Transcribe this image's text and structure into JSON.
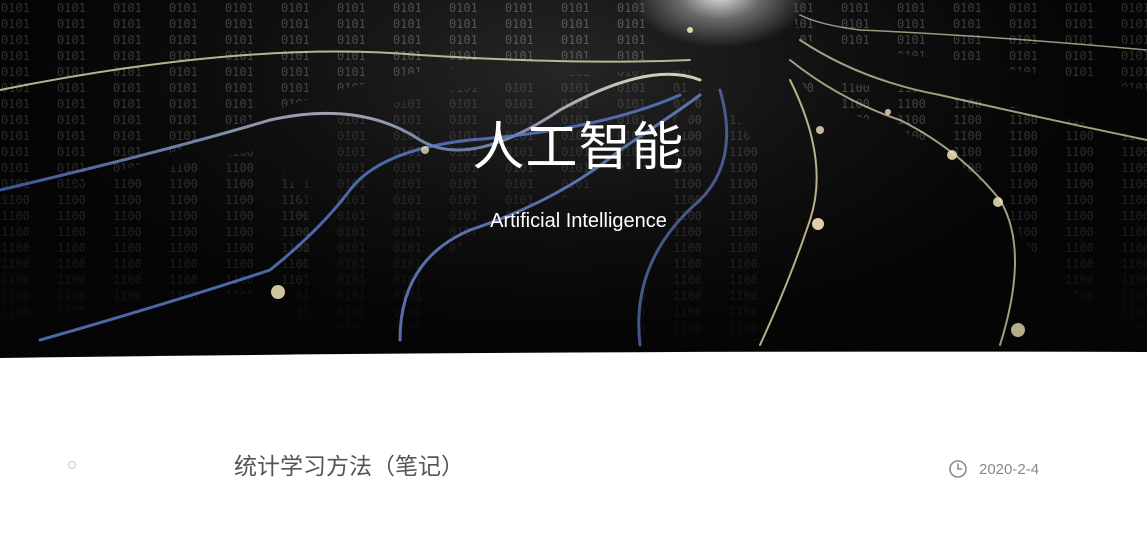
{
  "hero": {
    "title": "人工智能",
    "subtitle": "Artificial Intelligence",
    "background_icon": "neural-network-binary-image"
  },
  "posts": [
    {
      "bullet_icon": "circle-bullet-icon",
      "title": "统计学习方法（笔记）",
      "date_icon": "clock-icon",
      "date": "2020-2-4"
    }
  ]
}
